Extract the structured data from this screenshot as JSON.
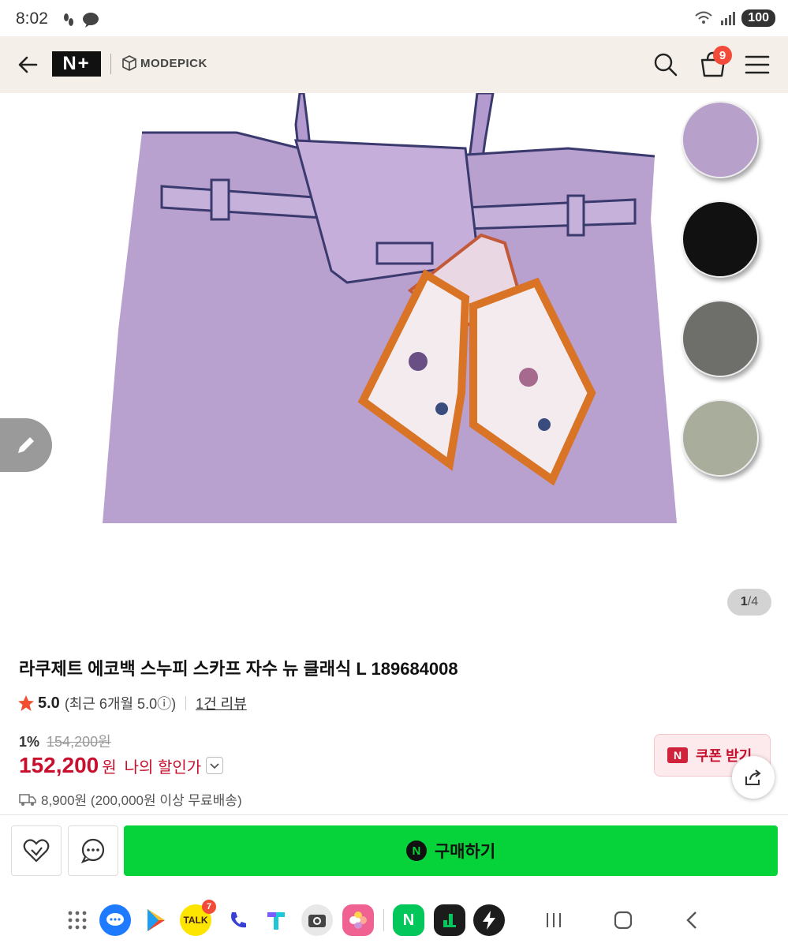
{
  "status_bar": {
    "time": "8:02",
    "battery": "100"
  },
  "header": {
    "brand_n": "N+",
    "brand_shop": "MODEPICK",
    "cart_count": "9"
  },
  "gallery": {
    "page_current": "1",
    "page_sep": " / ",
    "page_total": "4",
    "swatch_colors": [
      "#b7a0c9",
      "#111111",
      "#6e6e6b",
      "#a9ad9c"
    ]
  },
  "product": {
    "title": "라쿠제트 에코백 스누피 스카프 자수 뉴 클래식 L 189684008",
    "rating_score": "5.0",
    "rating_recent": "(최근 6개월 5.0ⓘ)",
    "review_link": "1건 리뷰",
    "discount_rate": "1%",
    "original_price": "154,200원",
    "price": "152,200",
    "price_unit": "원",
    "my_discount_label": "나의 할인가",
    "coupon_label": "쿠폰 받기",
    "coupon_badge": "N",
    "shipping": "8,900원 (200,000원 이상 무료배송)"
  },
  "actions": {
    "buy_label": "구매하기",
    "buy_badge": "N"
  },
  "dock": {
    "kakaotalk_badge": "7",
    "kakaotalk_label": "TALK"
  },
  "colors": {
    "price_red": "#c8102e",
    "buy_green": "#06d23a",
    "header_bg": "#f4efe8"
  }
}
